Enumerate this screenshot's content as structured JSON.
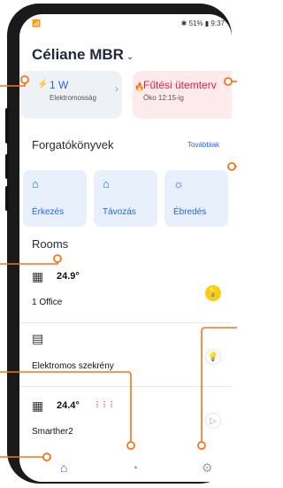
{
  "status": {
    "left": "📶",
    "right": "✱ 51% ▮ 9:37"
  },
  "header": {
    "title": "Céliane MBR",
    "chevron": "⌄"
  },
  "energy_card": {
    "icon": "⚡",
    "value": "1 W",
    "label": "Elektromosság",
    "chevron": "›"
  },
  "heat_card": {
    "icon": "🔥",
    "value": "Fűtési ütemterv",
    "label": "Öko 12:15-ig"
  },
  "scenes": {
    "title": "Forgatókönyvek",
    "more": "Továbbiak",
    "items": [
      {
        "label": "Érkezés",
        "icon": "⌂"
      },
      {
        "label": "Távozás",
        "icon": "⌂"
      },
      {
        "label": "Ébredés",
        "icon": "☼"
      }
    ]
  },
  "rooms": {
    "title": "Rooms",
    "items": [
      {
        "name": "1 Office",
        "temp": "24.9°",
        "icon": "▦",
        "badge": "💡",
        "heating": ""
      },
      {
        "name": "Elektromos szekrény",
        "temp": "",
        "icon": "▤",
        "badge": "💡",
        "heating": ""
      },
      {
        "name": "Smarther2",
        "temp": "24.4°",
        "icon": "▦",
        "badge": "▷",
        "heating": "⋮⋮⋮"
      }
    ]
  },
  "nav": {
    "home": "⌂",
    "history": "◔",
    "settings": "⚙"
  },
  "colors": {
    "accent": "#2563eb",
    "heat": "#e11d48",
    "badge_yellow": "#facc15",
    "annotation": "#f97316"
  }
}
